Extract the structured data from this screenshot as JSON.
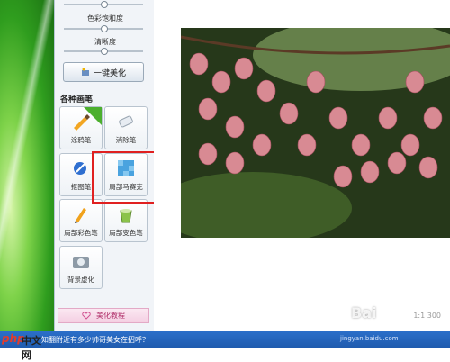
{
  "sliders": [
    {
      "label": "色彩饱和度"
    },
    {
      "label": "清晰度"
    }
  ],
  "beautify_button": "一键美化",
  "section_title": "各种画笔",
  "tools": [
    {
      "label": "涂鸦笔",
      "icon": "paint-brush-icon"
    },
    {
      "label": "消除笔",
      "icon": "eraser-icon"
    },
    {
      "label": "抠图笔",
      "icon": "cutout-pen-icon"
    },
    {
      "label": "局部马赛克",
      "icon": "mosaic-icon"
    },
    {
      "label": "局部彩色笔",
      "icon": "color-pen-icon"
    },
    {
      "label": "局部变色笔",
      "icon": "bucket-icon"
    },
    {
      "label": "背景虚化",
      "icon": "camera-blur-icon"
    }
  ],
  "tutorial_button": "美化教程",
  "status_message": "知翻附近有多少帅哥美女在招呼？",
  "zoom_readout": "1:1 300",
  "site_logo": {
    "php": "php",
    "cn": "中文网"
  },
  "watermark": "jingyan.baidu.com",
  "baidu_mark": "Bai"
}
